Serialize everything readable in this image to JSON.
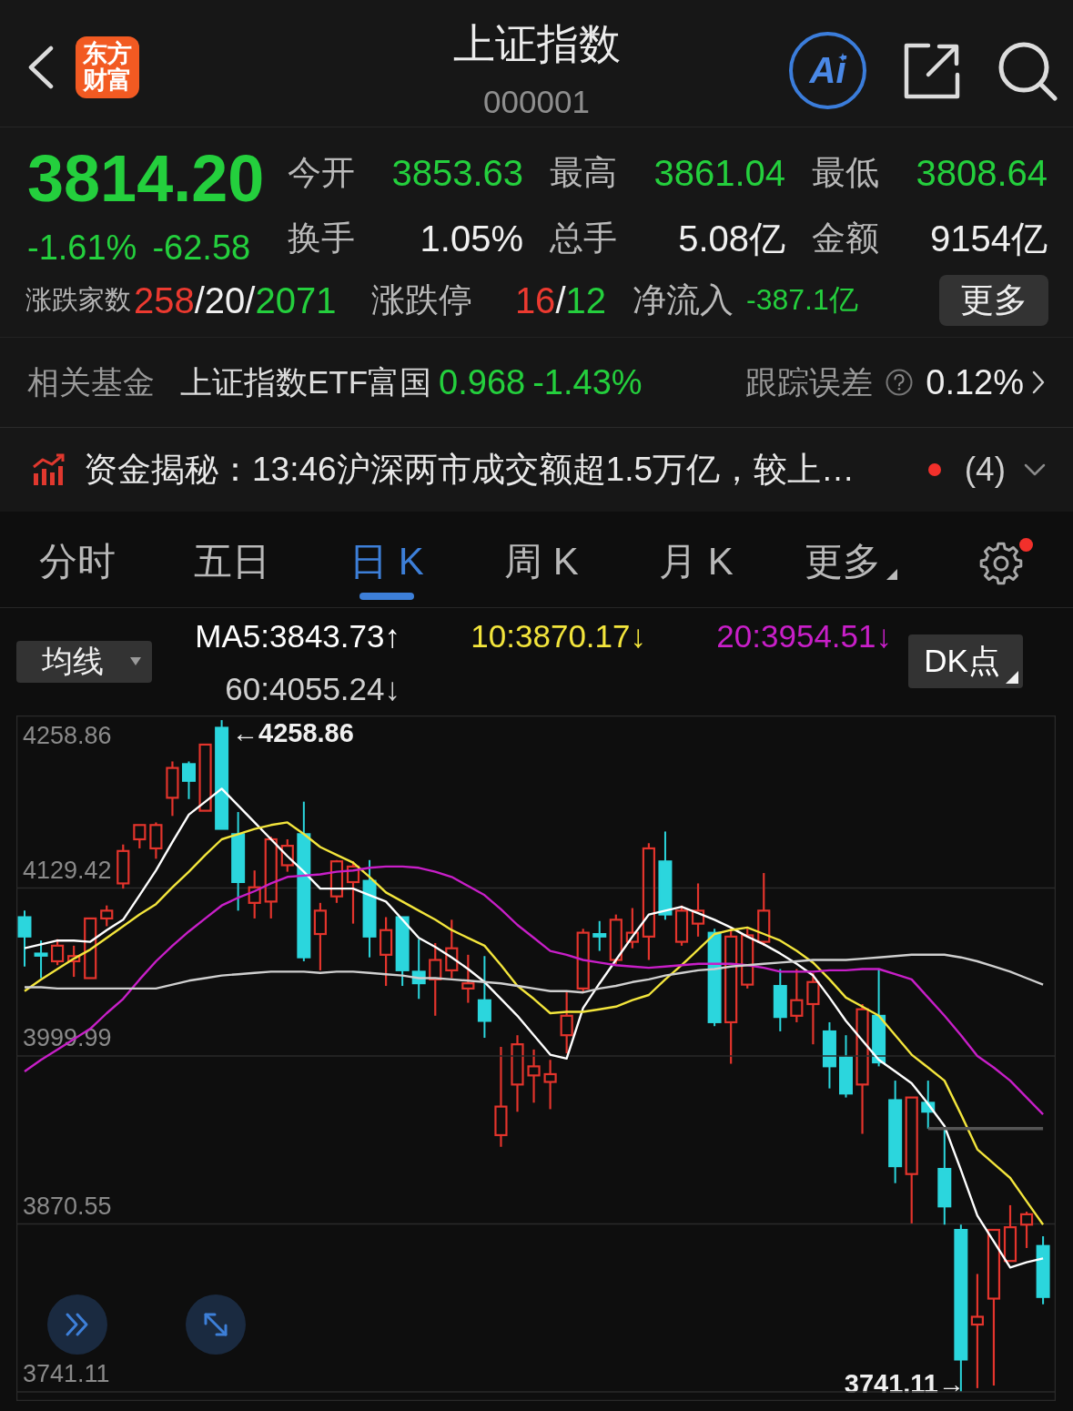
{
  "header": {
    "logo": "东方财富",
    "title": "上证指数",
    "code": "000001",
    "ai_label": "Ai"
  },
  "quote": {
    "price": "3814.20",
    "change_pct": "-1.61%",
    "change": "-62.58",
    "color": "#24cf3d",
    "stats": [
      {
        "label": "今开",
        "value": "3853.63",
        "color": "#24cf3d"
      },
      {
        "label": "最高",
        "value": "3861.04",
        "color": "#24cf3d"
      },
      {
        "label": "最低",
        "value": "3808.64",
        "color": "#24cf3d"
      },
      {
        "label": "换手",
        "value": "1.05%",
        "color": "#f0f0f0"
      },
      {
        "label": "总手",
        "value": "5.08亿",
        "color": "#f0f0f0"
      },
      {
        "label": "金额",
        "value": "9154亿",
        "color": "#f0f0f0"
      }
    ],
    "breadth": {
      "label": "涨跌家数",
      "parts": [
        {
          "text": "258",
          "color": "#ec3a30"
        },
        {
          "text": "/20/",
          "color": "#f0f0f0"
        },
        {
          "text": "2071",
          "color": "#24cf3d"
        }
      ]
    },
    "limits": {
      "label": "涨跌停",
      "parts": [
        {
          "text": "16",
          "color": "#ec3a30"
        },
        {
          "text": "/",
          "color": "#f0f0f0"
        },
        {
          "text": "12",
          "color": "#24cf3d"
        }
      ]
    },
    "net_inflow": {
      "label": "净流入",
      "value": "-387.1亿",
      "color": "#24cf3d"
    },
    "more_button": "更多"
  },
  "related_fund": {
    "label": "相关基金",
    "name": "上证指数ETF富国",
    "price": "0.968",
    "change": "-1.43%",
    "color": "#24cf3d",
    "tracking_label": "跟踪误差",
    "tracking_value": "0.12%"
  },
  "news": {
    "text": "资金揭秘：13:46沪深两市成交额超1.5万亿，较上…",
    "unread": true,
    "count": "(4)"
  },
  "tabs": [
    {
      "label": "分时",
      "selected": false,
      "kind": "tab"
    },
    {
      "label": "五日",
      "selected": false,
      "kind": "tab"
    },
    {
      "label": "日 K",
      "selected": true,
      "kind": "tab"
    },
    {
      "label": "周 K",
      "selected": false,
      "kind": "tab"
    },
    {
      "label": "月 K",
      "selected": false,
      "kind": "tab"
    },
    {
      "label": "更多",
      "selected": false,
      "kind": "menu"
    }
  ],
  "settings_badge": true,
  "indicator": {
    "selector": "均线",
    "ma": [
      {
        "text": "MA5:3843.73↑"
      },
      {
        "text": "10:3870.17↓"
      },
      {
        "text": "20:3954.51↓"
      },
      {
        "text": "60:4055.24↓"
      }
    ],
    "dk_button": "DK点"
  },
  "chart": {
    "range_max_label": "4258.86",
    "high_marker": "←4258.86",
    "low_marker": "3741.11→",
    "chart_data": {
      "type": "candlestick",
      "grid": true,
      "ylim": [
        3734.8,
        4262.4
      ],
      "yticks": [
        4129.42,
        3870.55
      ],
      "categories": [
        null,
        null,
        null,
        null,
        null,
        null,
        null,
        null,
        null,
        null,
        null,
        null,
        null,
        null,
        null,
        null,
        null,
        null,
        null,
        null,
        null,
        null,
        null,
        null,
        null,
        null,
        null,
        null,
        null,
        null,
        null,
        null,
        null,
        null,
        null,
        null,
        null,
        null,
        null,
        null,
        null,
        null,
        null,
        null,
        null,
        null,
        null,
        null,
        null,
        null,
        null,
        null,
        null,
        null,
        null,
        null,
        null,
        null,
        null,
        null,
        null,
        null,
        null
      ],
      "ohlc": [
        [
          4107,
          4112,
          4069,
          4092
        ],
        [
          4079,
          4089,
          4060,
          4078
        ],
        [
          4073,
          4090,
          4070,
          4085
        ],
        [
          4073,
          4085,
          4061,
          4077
        ],
        [
          4060,
          4106,
          4060,
          4106
        ],
        [
          4106,
          4116,
          4100,
          4112
        ],
        [
          4133,
          4163,
          4129,
          4158
        ],
        [
          4167,
          4178,
          4160,
          4178
        ],
        [
          4160,
          4180,
          4152,
          4178
        ],
        [
          4199,
          4227,
          4185,
          4222
        ],
        [
          4225,
          4227,
          4198,
          4212
        ],
        [
          4189,
          4240,
          4189,
          4240
        ],
        [
          4253,
          4258.86,
          4175,
          4175
        ],
        [
          4171,
          4188,
          4112,
          4134
        ],
        [
          4118,
          4143,
          4106,
          4130
        ],
        [
          4119,
          4169,
          4106,
          4167
        ],
        [
          4147,
          4167,
          4142,
          4162
        ],
        [
          4171,
          4196,
          4073,
          4076
        ],
        [
          4094,
          4118,
          4066,
          4112
        ],
        [
          4123,
          4151,
          4118,
          4150
        ],
        [
          4134,
          4150,
          4102,
          4146
        ],
        [
          4135,
          4151,
          4076,
          4092
        ],
        [
          4078,
          4107,
          4054,
          4097
        ],
        [
          4107,
          4107,
          4054,
          4066
        ],
        [
          4065,
          4090,
          4044,
          4056
        ],
        [
          4059,
          4087,
          4031,
          4074
        ],
        [
          4066,
          4105,
          4060,
          4083
        ],
        [
          4052,
          4078,
          4041,
          4056
        ],
        [
          4043,
          4077,
          4014,
          4027
        ],
        [
          3939,
          4007,
          3930,
          3961
        ],
        [
          3978,
          4016,
          3957,
          4009
        ],
        [
          3985,
          4005,
          3964,
          3992
        ],
        [
          3980,
          3997,
          3959,
          3986
        ],
        [
          4016,
          4050,
          4002,
          4031
        ],
        [
          4052,
          4098,
          4049,
          4095
        ],
        [
          4094,
          4104,
          4081,
          4092
        ],
        [
          4074,
          4109,
          4071,
          4105
        ],
        [
          4088,
          4114,
          4083,
          4095
        ],
        [
          4092,
          4164,
          4074,
          4160
        ],
        [
          4150,
          4173,
          4105,
          4109
        ],
        [
          4088,
          4116,
          4085,
          4112
        ],
        [
          4102,
          4133,
          4092,
          4112
        ],
        [
          4095,
          4098,
          4023,
          4026
        ],
        [
          4026,
          4098,
          3994,
          4092
        ],
        [
          4055,
          4098,
          4052,
          4093
        ],
        [
          4088,
          4141,
          4085,
          4112
        ],
        [
          4054,
          4067,
          4019,
          4030
        ],
        [
          4031,
          4067,
          4026,
          4043
        ],
        [
          4040,
          4064,
          4009,
          4057
        ],
        [
          4019,
          4026,
          3975,
          3992
        ],
        [
          3999,
          4016,
          3968,
          3971
        ],
        [
          3978,
          4040,
          3940,
          4036
        ],
        [
          4031,
          4067,
          3992,
          3995
        ],
        [
          3966,
          3981,
          3902,
          3915
        ],
        [
          3909,
          3968,
          3871,
          3968
        ],
        [
          3964,
          3981,
          3944,
          3957
        ],
        [
          3913,
          3944,
          3870,
          3884
        ],
        [
          3866,
          3870,
          3741.11,
          3766
        ],
        [
          3793,
          3832,
          3744,
          3799
        ],
        [
          3813,
          3866,
          3746,
          3866
        ],
        [
          3842,
          3885,
          3842,
          3868
        ],
        [
          3870,
          3880,
          3852,
          3878
        ],
        [
          3853.63,
          3861.04,
          3808.64,
          3814.2
        ]
      ]
    },
    "averages": {
      "chart_data": {
        "type": "line",
        "grid": true,
        "ylim": [
          3734.8,
          4262.4
        ],
        "yticks": [
          3999.99,
          3741.11
        ],
        "categories": [
          null,
          null,
          null,
          null,
          null,
          null,
          null,
          null,
          null,
          null,
          null,
          null,
          null,
          null,
          null,
          null,
          null,
          null,
          null,
          null,
          null,
          null,
          null,
          null,
          null,
          null,
          null,
          null,
          null,
          null,
          null,
          null,
          null,
          null,
          null,
          null,
          null,
          null,
          null,
          null,
          null,
          null,
          null,
          null,
          null,
          null,
          null,
          null,
          null,
          null,
          null,
          null,
          null,
          null,
          null,
          null,
          null,
          null,
          null,
          null,
          null,
          null,
          null
        ],
        "series": [
          {
            "color": "#ffffff",
            "values": [
              4083,
              4086,
              4089,
              4089,
              4088,
              4097,
              4105,
              4124,
              4143,
              4165,
              4186,
              4196,
              4206,
              4193,
              4180,
              4167,
              4154,
              4142,
              4129,
              4129,
              4129,
              4124,
              4119,
              4105,
              4091,
              4084,
              4076,
              4067,
              4057,
              4044,
              4031,
              4016,
              4001,
              3998,
              4037,
              4056,
              4074,
              4092,
              4109,
              4112,
              4115,
              4110,
              4105,
              4099,
              4092,
              4086,
              4079,
              4071,
              4062,
              4045,
              4027,
              4012,
              3997,
              3988,
              3979,
              3963,
              3946,
              3912,
              3877,
              3857,
              3837,
              3841,
              3844
            ]
          },
          {
            "color": "#f3e53c",
            "values": [
              4050,
              4059,
              4067,
              4075,
              4082,
              4091,
              4100,
              4109,
              4117,
              4130,
              4142,
              4155,
              4167,
              4171,
              4175,
              4178,
              4180,
              4171,
              4161,
              4155,
              4149,
              4138,
              4126,
              4119,
              4112,
              4105,
              4097,
              4091,
              4085,
              4070,
              4054,
              4044,
              4033,
              4034,
              4034,
              4036,
              4038,
              4043,
              4047,
              4059,
              4070,
              4082,
              4094,
              4097,
              4099,
              4094,
              4089,
              4081,
              4072,
              4059,
              4045,
              4038,
              4031,
              4016,
              4001,
              3991,
              3981,
              3955,
              3928,
              3917,
              3906,
              3888,
              3870
            ]
          },
          {
            "color": "#c81fc8",
            "values": [
              3988,
              3997,
              4005,
              4013,
              4021,
              4033,
              4044,
              4059,
              4073,
              4085,
              4096,
              4106,
              4116,
              4122,
              4127,
              4133,
              4138,
              4139,
              4140,
              4142,
              4143,
              4145,
              4146,
              4146,
              4145,
              4142,
              4138,
              4131,
              4124,
              4113,
              4101,
              4091,
              4081,
              4078,
              4074,
              4072,
              4070,
              4069,
              4068,
              4069,
              4070,
              4071,
              4071,
              4071,
              4070,
              4068,
              4065,
              4065,
              4065,
              4066,
              4066,
              4067,
              4067,
              4063,
              4059,
              4045,
              4031,
              4016,
              4000,
              3991,
              3981,
              3968,
              3955
            ]
          },
          {
            "color": "#cfcfcf",
            "values": [
              4053,
              4053,
              4052,
              4052,
              4052,
              4052,
              4052,
              4052,
              4052,
              4055,
              4058,
              4060,
              4062,
              4063,
              4064,
              4065,
              4065,
              4065,
              4064,
              4065,
              4065,
              4064,
              4063,
              4062,
              4060,
              4060,
              4059,
              4058,
              4057,
              4056,
              4054,
              4052,
              4050,
              4050,
              4049,
              4052,
              4054,
              4057,
              4059,
              4062,
              4064,
              4066,
              4067,
              4069,
              4070,
              4071,
              4072,
              4073,
              4074,
              4074,
              4074,
              4075,
              4076,
              4077,
              4078,
              4078,
              4078,
              4076,
              4073,
              4069,
              4065,
              4060,
              4055
            ]
          },
          {
            "color": "#555555",
            "values": [
              null,
              null,
              null,
              null,
              null,
              null,
              null,
              null,
              null,
              null,
              null,
              null,
              null,
              null,
              null,
              null,
              null,
              null,
              null,
              null,
              null,
              null,
              null,
              null,
              null,
              null,
              null,
              null,
              null,
              null,
              null,
              null,
              null,
              null,
              null,
              null,
              null,
              null,
              null,
              null,
              null,
              null,
              null,
              null,
              null,
              null,
              null,
              null,
              null,
              null,
              null,
              null,
              null,
              null,
              null,
              3944,
              3944,
              3944,
              3944,
              3944,
              3944,
              3944,
              3944
            ]
          }
        ]
      }
    }
  }
}
